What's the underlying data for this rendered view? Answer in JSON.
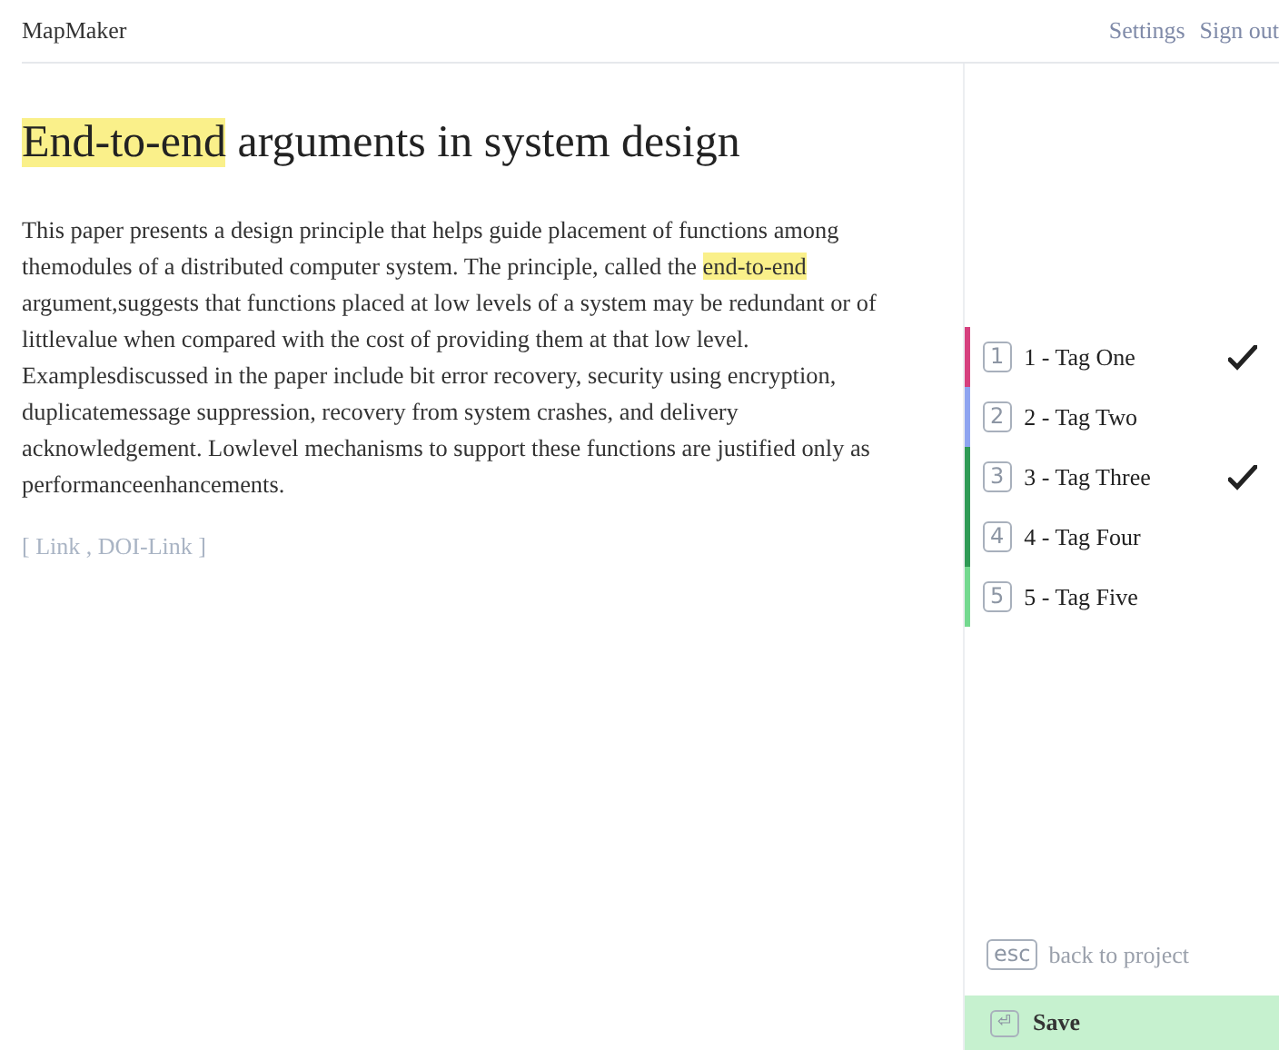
{
  "header": {
    "app_name": "MapMaker",
    "links": [
      "Settings",
      "Sign out"
    ]
  },
  "paper": {
    "title": [
      {
        "text": "End-to-end",
        "highlighted": true
      },
      {
        "text": " arguments in system design",
        "highlighted": false
      }
    ],
    "abstract": [
      {
        "text": "This paper presents a design principle that helps guide placement of functions among themodules of a distributed computer system. The principle, called the ",
        "highlighted": false
      },
      {
        "text": "end-to-end",
        "highlighted": true
      },
      {
        "text": " argument,suggests that functions placed at low levels of a system may be redundant or of littlevalue when compared with the cost of providing them at that low level. Examplesdiscussed in the paper include bit error recovery, security using encryption, duplicatemessage suppression, recovery from system crashes, and delivery acknowledgement. Lowlevel mechanisms to support these functions are justified only as performanceenhancements.",
        "highlighted": false
      }
    ],
    "links_text": "[ Link , DOI-Link ]"
  },
  "tags": [
    {
      "key": "1",
      "label": "1 - Tag One",
      "color": "#d6407e",
      "checked": true
    },
    {
      "key": "2",
      "label": "2 - Tag Two",
      "color": "#8ea4f0",
      "checked": false
    },
    {
      "key": "3",
      "label": "3 - Tag Three",
      "color": "#2f9a55",
      "checked": true
    },
    {
      "key": "4",
      "label": "4 - Tag Four",
      "color": "#2f9a55",
      "checked": false
    },
    {
      "key": "5",
      "label": "5 - Tag Five",
      "color": "#74d98f",
      "checked": false
    }
  ],
  "back": {
    "key": "esc",
    "label": "back to project"
  },
  "save": {
    "key": "⏎",
    "label": "Save"
  }
}
